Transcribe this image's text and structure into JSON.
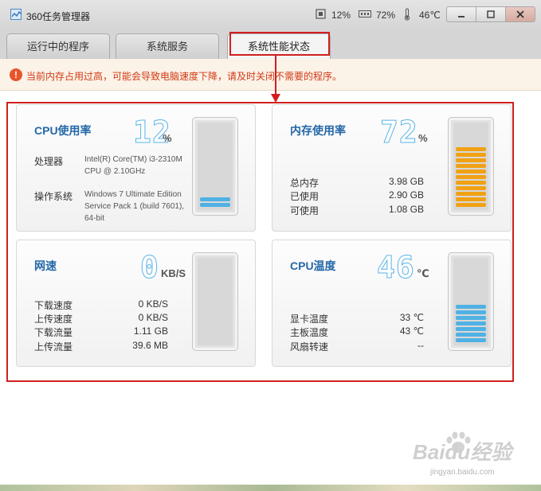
{
  "titlebar": {
    "app_title": "360任务管理器",
    "cpu_stat": "12%",
    "mem_stat": "72%",
    "temp_stat": "46℃",
    "buttons": [
      "minimize-icon",
      "maximize-icon",
      "close-icon"
    ]
  },
  "tabs": [
    {
      "label": "运行中的程序",
      "active": false
    },
    {
      "label": "系统服务",
      "active": false
    },
    {
      "label": "系统性能状态",
      "active": true
    }
  ],
  "warning": {
    "icon": "!",
    "text": "当前内存占用过高，可能会导致电脑速度下降，请及时关闭不需要的程序。"
  },
  "panels": {
    "cpu": {
      "title": "CPU使用率",
      "value": "12",
      "unit": "%",
      "processor_label": "处理器",
      "processor_value": [
        "Intel(R) Core(TM) i3-2310M",
        "CPU @ 2.10GHz"
      ],
      "os_label": "操作系统",
      "os_value": [
        "Windows 7 Ultimate Edition",
        "Service Pack 1 (build 7601),",
        "64-bit"
      ],
      "level": 0.12
    },
    "memory": {
      "title": "内存使用率",
      "value": "72",
      "unit": "%",
      "rows": [
        {
          "label": "总内存",
          "value": "3.98 GB"
        },
        {
          "label": "已使用",
          "value": "2.90 GB"
        },
        {
          "label": "可使用",
          "value": "1.08 GB"
        }
      ],
      "level": 0.72
    },
    "network": {
      "title": "网速",
      "value": "0",
      "unit": "KB/S",
      "rows": [
        {
          "label": "下载速度",
          "value": "0 KB/S"
        },
        {
          "label": "上传速度",
          "value": "0 KB/S"
        },
        {
          "label": "下载流量",
          "value": "1.11 GB"
        },
        {
          "label": "上传流量",
          "value": "39.6 MB"
        }
      ],
      "level": 0
    },
    "temperature": {
      "title": "CPU温度",
      "value": "46",
      "unit": "℃",
      "rows": [
        {
          "label": "显卡温度",
          "value": "33 ℃"
        },
        {
          "label": "主板温度",
          "value": "43 ℃"
        },
        {
          "label": "风扇转速",
          "value": "--"
        }
      ],
      "level": 0.46
    }
  },
  "watermark": {
    "main": "Baidu经验",
    "sub": "jingyan.baidu.com"
  },
  "colors": {
    "accent_red": "#d21e1e",
    "gauge_blue": "#4fb1e4",
    "gauge_orange": "#f1a114",
    "title_blue": "#2468a8"
  }
}
